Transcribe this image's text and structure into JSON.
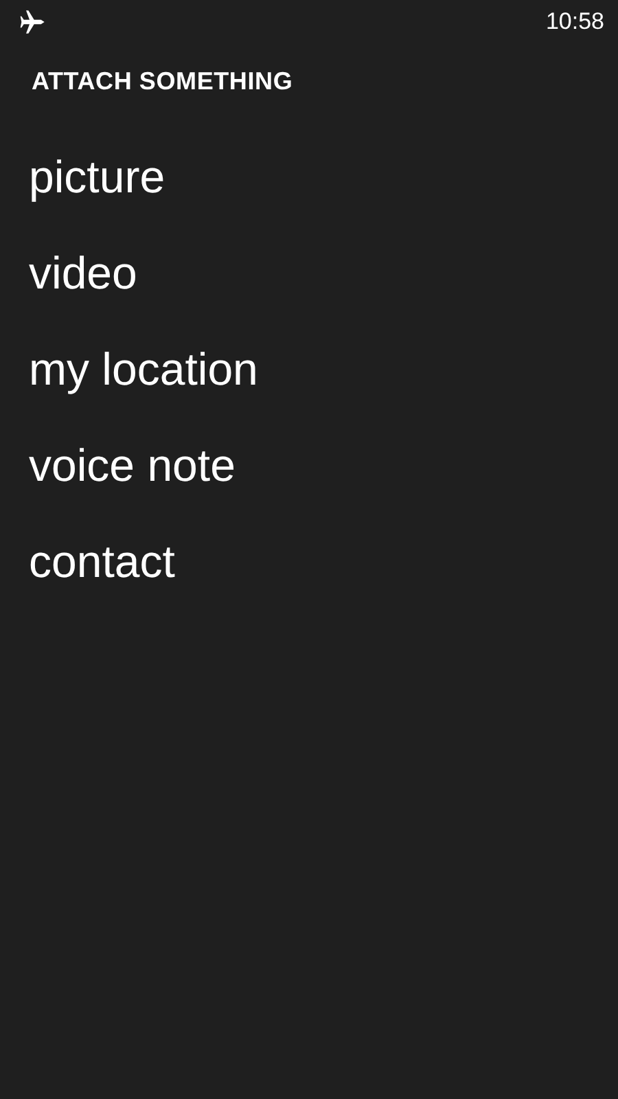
{
  "status_bar": {
    "time": "10:58"
  },
  "title": "ATTACH SOMETHING",
  "items": [
    {
      "label": "picture"
    },
    {
      "label": "video"
    },
    {
      "label": "my location"
    },
    {
      "label": "voice note"
    },
    {
      "label": "contact"
    }
  ]
}
